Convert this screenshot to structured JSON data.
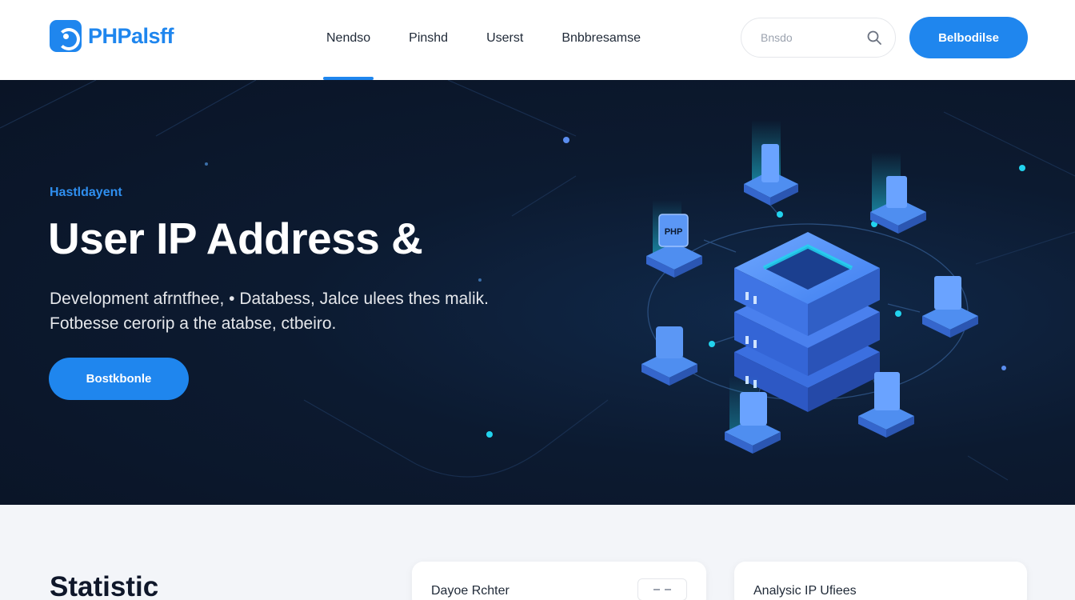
{
  "header": {
    "logo_text": "PHPalsff",
    "nav": [
      {
        "label": "Nendso",
        "active": true
      },
      {
        "label": "Pinshd",
        "active": false
      },
      {
        "label": "Userst",
        "active": false
      },
      {
        "label": "Bnbbresamse",
        "active": false
      }
    ],
    "search_placeholder": "Bnsdo",
    "cta_label": "Belbodilse"
  },
  "hero": {
    "eyebrow": "Hastldayent",
    "title": "User IP Address &",
    "description_line1": "Development afrntfhee, • Databess, Jalce ulees thes malik.",
    "description_line2": "Fotbesse cerorip a the atabse, ctbeiro.",
    "button_label": "Bostkbonle",
    "illustration_labels": [
      "PHP"
    ]
  },
  "stats": {
    "title": "Statistic",
    "cards": [
      {
        "title": "Dayoe Rchter"
      },
      {
        "title": "Analysic IP Ufiees"
      }
    ]
  },
  "colors": {
    "accent": "#1f86ee",
    "hero_bg": "#0c1a30",
    "glow": "#22d3ee"
  },
  "icons": [
    "logo-mark-icon",
    "search-icon",
    "server-stack-icon",
    "menu-icon"
  ]
}
